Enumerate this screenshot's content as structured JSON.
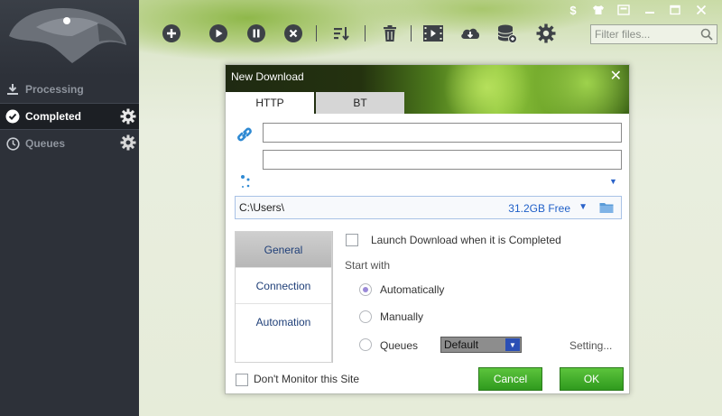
{
  "sidebar": {
    "items": [
      {
        "label": "Processing",
        "icon": "download-icon",
        "active": false
      },
      {
        "label": "Completed",
        "icon": "check-circle-icon",
        "active": true
      },
      {
        "label": "Queues",
        "icon": "clock-icon",
        "active": false
      }
    ]
  },
  "toolbar": {
    "buttons": [
      "add-icon",
      "play-icon",
      "pause-icon",
      "stop-icon",
      "sort-icon",
      "trash-icon",
      "video-icon",
      "cloud-download-icon",
      "database-icon",
      "gear-icon"
    ],
    "filter_placeholder": "Filter files..."
  },
  "window_controls": [
    "dollar-icon",
    "shirt-icon",
    "restore-icon",
    "minimize-icon",
    "maximize-icon",
    "close-icon"
  ],
  "dialog": {
    "title": "New Download",
    "tabs": [
      {
        "label": "HTTP",
        "active": true
      },
      {
        "label": "BT",
        "active": false
      }
    ],
    "url_value": "",
    "filename_value": "",
    "path": {
      "value": "C:\\Users\\",
      "free": "31.2GB Free"
    },
    "side_tabs": [
      {
        "label": "General",
        "active": true
      },
      {
        "label": "Connection",
        "active": false
      },
      {
        "label": "Automation",
        "active": false
      }
    ],
    "launch_label": "Launch Download when it is Completed",
    "start_with_label": "Start with",
    "start_options": [
      {
        "label": "Automatically",
        "selected": true
      },
      {
        "label": "Manually",
        "selected": false
      },
      {
        "label": "Queues",
        "selected": false
      }
    ],
    "queue_value": "Default",
    "setting_link": "Setting...",
    "monitor_label": "Don't Monitor this Site",
    "cancel_label": "Cancel",
    "ok_label": "OK"
  },
  "colors": {
    "sidebar_bg": "#2d3139",
    "accent_green": "#3aa628",
    "link_blue": "#2060c8"
  }
}
